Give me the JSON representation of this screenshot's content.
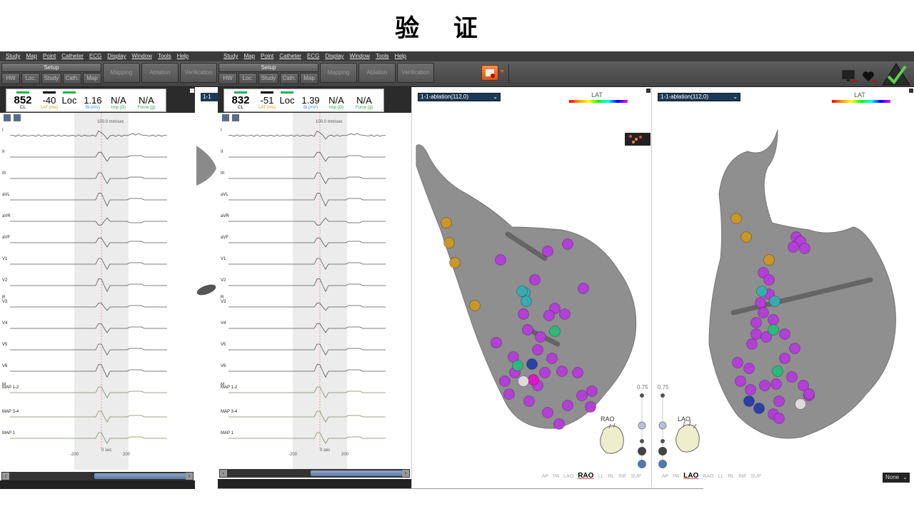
{
  "slide": {
    "title": "验 证"
  },
  "menu": [
    "Study",
    "Map",
    "Point",
    "Catheter",
    "ECG",
    "Display",
    "Window",
    "Tools",
    "Help"
  ],
  "toolbar": {
    "setup_label": "Setup",
    "setup_items": [
      "HW",
      "Loc.",
      "Study",
      "Cath.",
      "Map"
    ],
    "modes": [
      "Mapping",
      "Ablation",
      "Verification"
    ]
  },
  "left": {
    "readouts": [
      {
        "value": "852",
        "label": "CL",
        "color": "#22b24c",
        "label_color": "#000000"
      },
      {
        "value": "-40",
        "label": "LAT (ms)",
        "color": "#000000",
        "label_color": "#c9a100"
      },
      {
        "value": "Loc",
        "label": "",
        "color": "#22b24c",
        "label_color": "#000000"
      },
      {
        "value": "1.16",
        "label": "Bi (mV)",
        "color": "",
        "label_color": "#1e90ff"
      },
      {
        "value": "N/A",
        "label": "Imp (Ω)",
        "color": "",
        "label_color": "#22aa44"
      },
      {
        "value": "N/A",
        "label": "Force (g)",
        "color": "",
        "label_color": "#3fa050"
      }
    ],
    "speed": "100.0 mm/sec",
    "time_labels": [
      "-200",
      "0 sec",
      "200"
    ],
    "tab_fragment": "1-1"
  },
  "middle": {
    "readouts": [
      {
        "value": "832",
        "label": "CL",
        "color": "#22b24c",
        "label_color": "#000000"
      },
      {
        "value": "-51",
        "label": "LAT (ms)",
        "color": "#000000",
        "label_color": "#c9a100"
      },
      {
        "value": "Loc",
        "label": "",
        "color": "#22b24c",
        "label_color": "#000000"
      },
      {
        "value": "1.39",
        "label": "Bi (mV)",
        "color": "",
        "label_color": "#1e90ff"
      },
      {
        "value": "N/A",
        "label": "Imp (Ω)",
        "color": "",
        "label_color": "#22aa44"
      },
      {
        "value": "N/A",
        "label": "Force (g)",
        "color": "",
        "label_color": "#3fa050"
      }
    ],
    "speed": "100.0 mm/sec",
    "time_labels": [
      "-200",
      "0 sec",
      "200"
    ]
  },
  "leads": [
    "I",
    "II",
    "III",
    "aVL",
    "aVR",
    "aVF",
    "V1",
    "V2",
    "V3",
    "V4",
    "V5",
    "V6",
    "MAP 1-2",
    "MAP 3-4",
    "MAP 1"
  ],
  "lead_markers": {
    "r": "R",
    "m": "M"
  },
  "map_left": {
    "select": "1-1-ablation(112,0)",
    "lat": "LAT",
    "slider_value": "0.75",
    "orientation": "RAO",
    "views": [
      "AP",
      "PA",
      "LAO",
      "RAO",
      "LL",
      "RL",
      "INF",
      "SUP"
    ],
    "active_view": "RAO"
  },
  "map_right": {
    "select": "1-1-ablation(112,0)",
    "lat": "LAT",
    "slider_value": "0.75",
    "orientation": "LAO",
    "views": [
      "AP",
      "PA",
      "LAO",
      "RAO",
      "LL",
      "RL",
      "INF",
      "SUP"
    ],
    "active_view": "LAO",
    "none_label": "None"
  },
  "colors": {
    "menubar": "#3b3b3b",
    "toolbar": "#505050",
    "map_select": "#1d3a55",
    "mesh": "#8a8a8a"
  },
  "icons": {
    "orange": "map-tool-icon",
    "monitor": "monitor-icon",
    "heart": "heart-status-icon",
    "check": "verified-check-icon"
  }
}
